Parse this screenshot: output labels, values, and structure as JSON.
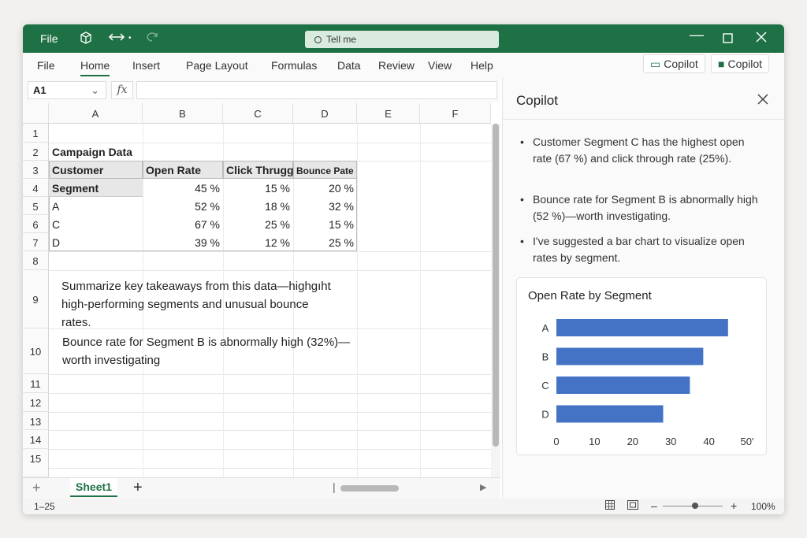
{
  "titlebar": {
    "file": "File",
    "tell_me": "Tell me",
    "controls": [
      "minimize-icon",
      "maximize-icon",
      "close-icon"
    ]
  },
  "ribbon": {
    "tabs": [
      "File",
      "Home",
      "Insert",
      "Page Layout",
      "Formulas",
      "Data",
      "Review",
      "View",
      "Help"
    ],
    "active_tab": "Home",
    "copilot_buttons": [
      "Copilot",
      "Copilot"
    ]
  },
  "formula_bar": {
    "name_box": "A1",
    "fx": "fx",
    "formula": ""
  },
  "sheet": {
    "columns": [
      "A",
      "B",
      "C",
      "D",
      "E",
      "F"
    ],
    "rows": [
      "1",
      "2",
      "3",
      "4",
      "5",
      "6",
      "7",
      "8",
      "9",
      "10",
      "11",
      "12",
      "13",
      "14",
      "15"
    ],
    "title_cell": "Campaign Data",
    "headers": [
      "Customer",
      "Open Rate",
      "Click Thrugg",
      "Bounce Pate"
    ],
    "subheader": "Segment",
    "table_rows": [
      {
        "segment": "",
        "open": "45 %",
        "click": "15 %",
        "bounce": "20 %"
      },
      {
        "segment": "A",
        "open": "52 %",
        "click": "18 %",
        "bounce": "32 %"
      },
      {
        "segment": "C",
        "open": "67 %",
        "click": "25 %",
        "bounce": "15 %"
      },
      {
        "segment": "D",
        "open": "39 %",
        "click": "12 %",
        "bounce": "25 %"
      }
    ],
    "prompt_text": "Summarize key takeaways from this data—highgı ht high-performing segments and unusual bounce rates.",
    "prompt_lines": [
      "Summarize key takeaways from this data—highgıht",
      "high-performing segments and unusual bounce",
      "rates."
    ],
    "response_lines": [
      "Bounce  rate for Segment B is abnormally high (32%)—",
      "worth investigating"
    ]
  },
  "sheet_tabs": {
    "active": "Sheet1"
  },
  "status_bar": {
    "left": "1–25",
    "zoom": "100%"
  },
  "copilot": {
    "title": "Copilot",
    "bullets": [
      "Customer Segment C has the highest open rate (67 %) and click through rate (25%).",
      "Bounce rate for Segment B is abnormally high (52 %)—worth investigating.",
      "I've suggested a bar chart to visualize open rates by segment."
    ]
  },
  "colors": {
    "excel_green": "#1e7145",
    "bar_blue": "#4472c4"
  },
  "chart_data": {
    "type": "bar",
    "orientation": "horizontal",
    "title": "Open Rate by Segment",
    "categories": [
      "A",
      "B",
      "C",
      "D"
    ],
    "values": [
      45,
      38.5,
      35,
      28
    ],
    "xlim": [
      0,
      50
    ],
    "xticks": [
      "0",
      "10",
      "20",
      "30",
      "40",
      "50'"
    ],
    "grid": false
  }
}
